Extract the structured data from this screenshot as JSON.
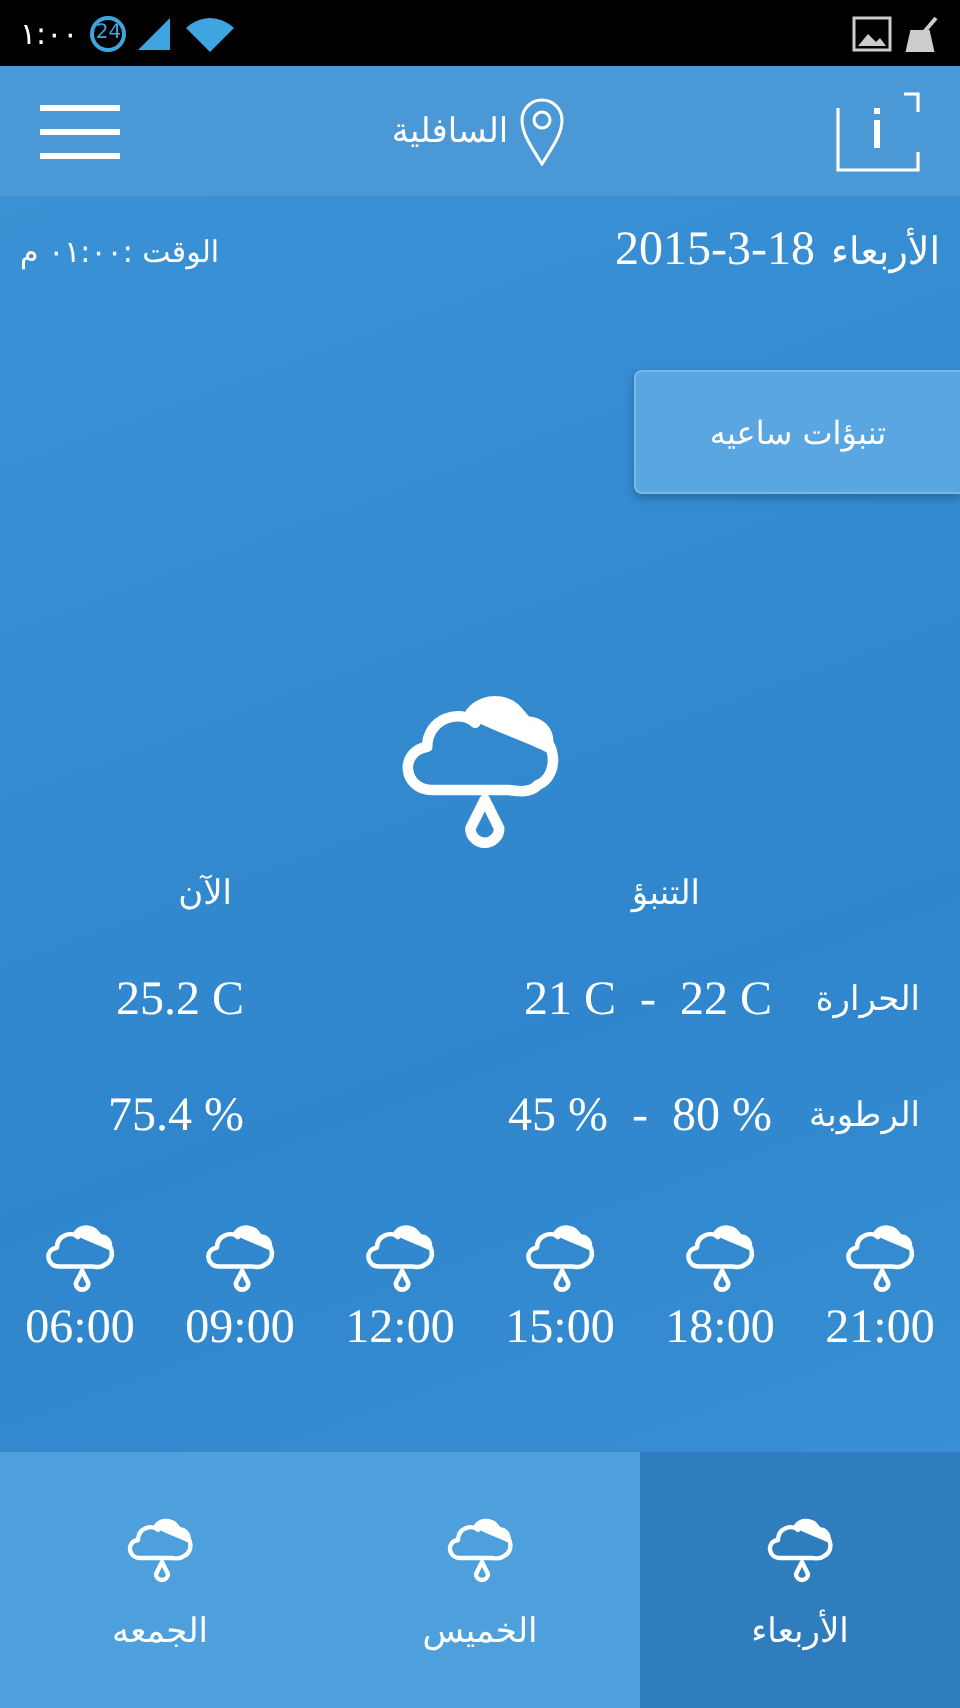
{
  "status_bar": {
    "time": "١:٠٠",
    "badge": "24"
  },
  "app_bar": {
    "location": "السافلية"
  },
  "date": {
    "weekday": "الأربعاء",
    "date": "2015-3-18",
    "time": "الوقت :٠١:٠٠ م"
  },
  "hourly_button": "تنبؤات ساعيه",
  "forecast": {
    "forecast_heading": "التنبؤ",
    "now_heading": "الآن",
    "rows": [
      {
        "label": "الحرارة",
        "high": "22 C",
        "dash": "-",
        "low": "21 C",
        "now": "25.2 C"
      },
      {
        "label": "الرطوبة",
        "high": "80 %",
        "dash": "-",
        "low": "45 %",
        "now": "75.4 %"
      }
    ]
  },
  "hours": [
    "21:00",
    "18:00",
    "15:00",
    "12:00",
    "09:00",
    "06:00"
  ],
  "days": [
    {
      "label": "الأربعاء",
      "selected": true
    },
    {
      "label": "الخميس",
      "selected": false
    },
    {
      "label": "الجمعه",
      "selected": false
    }
  ]
}
